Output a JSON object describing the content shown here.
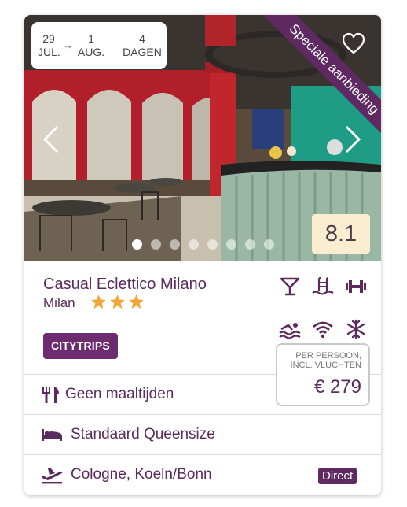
{
  "dates": {
    "start_day": "29",
    "start_month": "JUL.",
    "end_day": "1",
    "end_month": "AUG.",
    "duration_number": "4",
    "duration_unit": "DAGEN"
  },
  "ribbon": "Speciale aanbieding",
  "rating": "8.1",
  "carousel": {
    "slide_count": 8,
    "active_index": 0
  },
  "hotel": {
    "name": "Casual Eclettico Milano",
    "city": "Milan",
    "stars": 3
  },
  "facilities": [
    "cocktail-bar-icon",
    "pool-icon",
    "gym-icon",
    "swimming-icon",
    "wifi-icon",
    "air-conditioning-icon"
  ],
  "tag": "CITYTRIPS",
  "price": {
    "label_line1": "PER PERSOON,",
    "label_line2": "INCL. VLUCHTEN",
    "value": "€ 279"
  },
  "rows": {
    "meals": "Geen maaltijden",
    "room": "Standaard Queensize",
    "flight": "Cologne, Koeln/Bonn",
    "flight_badge": "Direct"
  },
  "colors": {
    "brand_purple": "#5e2a61",
    "star_gold": "#f0a636",
    "rating_bg": "#fbeed0"
  }
}
